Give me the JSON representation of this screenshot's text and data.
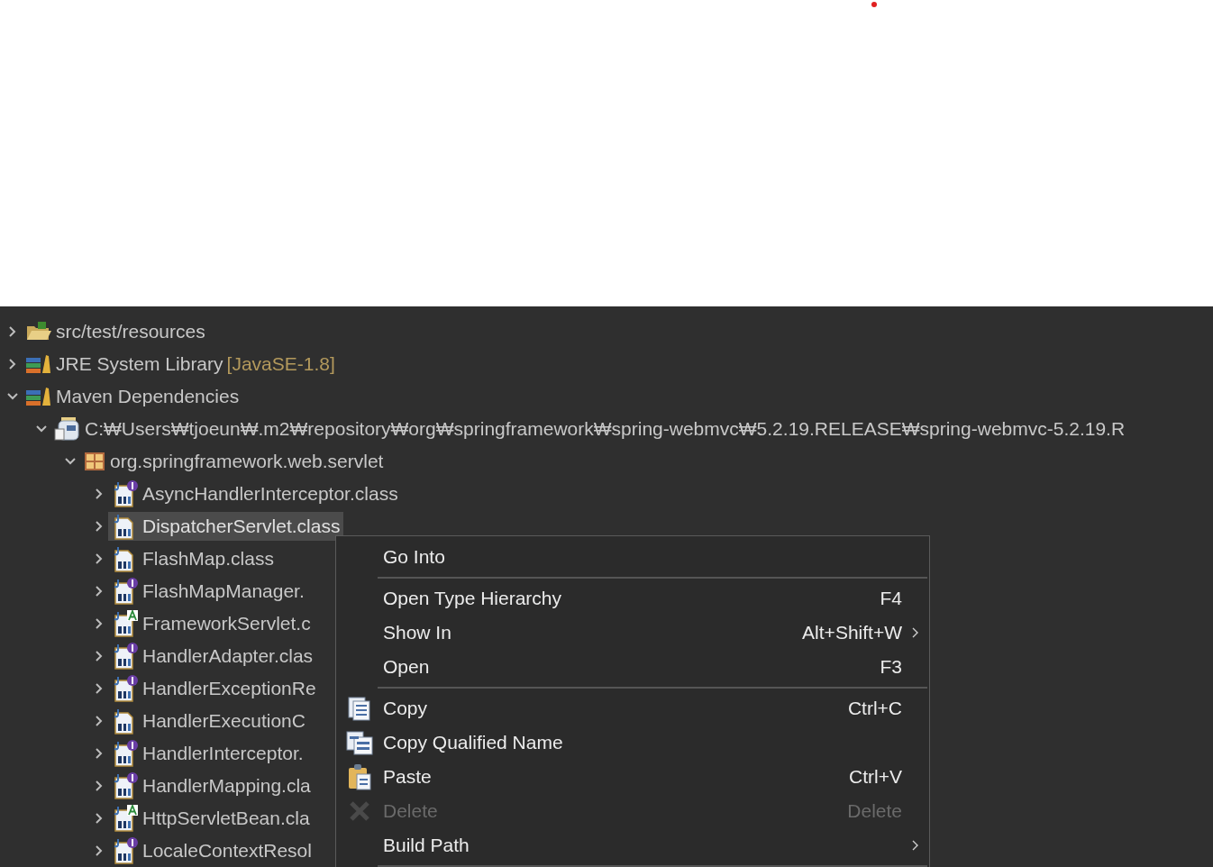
{
  "tree": [
    {
      "label": "src/test/resources",
      "kind": "source-folder",
      "expanded": false,
      "selected": false
    },
    {
      "label": "JRE System Library",
      "suffix": "[JavaSE-1.8]",
      "kind": "library",
      "expanded": false,
      "selected": false
    },
    {
      "label": "Maven Dependencies",
      "kind": "library",
      "expanded": true,
      "selected": false,
      "children": [
        {
          "label": "C:₩Users₩tjoeun₩.m2₩repository₩org₩springframework₩spring-webmvc₩5.2.19.RELEASE₩spring-webmvc-5.2.19.R",
          "kind": "jar",
          "expanded": true,
          "selected": false,
          "children": [
            {
              "label": "org.springframework.web.servlet",
              "kind": "package",
              "expanded": true,
              "selected": false,
              "children": [
                {
                  "label": "AsyncHandlerInterceptor.class",
                  "kind": "interface",
                  "expanded": false,
                  "selected": false
                },
                {
                  "label": "DispatcherServlet.class",
                  "kind": "class",
                  "expanded": false,
                  "selected": true
                },
                {
                  "label": "FlashMap.class",
                  "kind": "class",
                  "expanded": false,
                  "selected": false
                },
                {
                  "label": "FlashMapManager.",
                  "kind": "interface",
                  "expanded": false,
                  "selected": false
                },
                {
                  "label": "FrameworkServlet.c",
                  "kind": "abstract",
                  "expanded": false,
                  "selected": false
                },
                {
                  "label": "HandlerAdapter.clas",
                  "kind": "interface",
                  "expanded": false,
                  "selected": false
                },
                {
                  "label": "HandlerExceptionRe",
                  "kind": "interface",
                  "expanded": false,
                  "selected": false
                },
                {
                  "label": "HandlerExecutionC",
                  "kind": "class",
                  "expanded": false,
                  "selected": false
                },
                {
                  "label": "HandlerInterceptor.",
                  "kind": "interface",
                  "expanded": false,
                  "selected": false
                },
                {
                  "label": "HandlerMapping.cla",
                  "kind": "interface",
                  "expanded": false,
                  "selected": false
                },
                {
                  "label": "HttpServletBean.cla",
                  "kind": "abstract",
                  "expanded": false,
                  "selected": false
                },
                {
                  "label": "LocaleContextResol",
                  "kind": "interface",
                  "expanded": false,
                  "selected": false
                }
              ]
            }
          ]
        }
      ]
    }
  ],
  "context_menu": {
    "groups": [
      [
        {
          "label": "Go Into",
          "disabled": false,
          "submenu": false
        }
      ],
      [
        {
          "label": "Open Type Hierarchy",
          "shortcut": "F4",
          "disabled": false,
          "submenu": false
        },
        {
          "label": "Show In",
          "shortcut": "Alt+Shift+W",
          "disabled": false,
          "submenu": true
        },
        {
          "label": "Open",
          "shortcut": "F3",
          "disabled": false,
          "submenu": false
        }
      ],
      [
        {
          "label": "Copy",
          "shortcut": "Ctrl+C",
          "kind": "copy",
          "disabled": false,
          "submenu": false
        },
        {
          "label": "Copy Qualified Name",
          "kind": "copy-name",
          "disabled": false,
          "submenu": false
        },
        {
          "label": "Paste",
          "shortcut": "Ctrl+V",
          "kind": "paste",
          "disabled": false,
          "submenu": false
        },
        {
          "label": "Delete",
          "shortcut": "Delete",
          "kind": "delete",
          "disabled": true,
          "submenu": false
        },
        {
          "label": "Build Path",
          "disabled": false,
          "submenu": true
        }
      ]
    ]
  }
}
